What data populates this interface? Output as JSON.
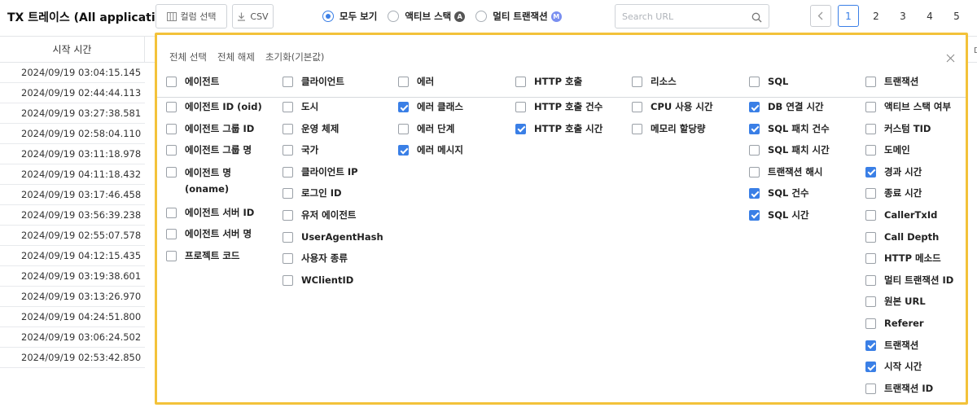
{
  "toolbar": {
    "title": "TX 트레이스 (All applications)",
    "column_select_label": "컬럼 선택",
    "csv_label": "CSV",
    "radios": [
      {
        "label": "모두 보기",
        "selected": true,
        "badge": ""
      },
      {
        "label": "액티브 스택",
        "selected": false,
        "badge": "A",
        "badge_color": "#555555"
      },
      {
        "label": "멀티 트랜잭션",
        "selected": false,
        "badge": "M",
        "badge_color": "#7a8ff0"
      }
    ],
    "search_placeholder": "Search URL",
    "pages": [
      "1",
      "2",
      "3",
      "4",
      "5"
    ],
    "active_page": "1"
  },
  "table": {
    "column_header": "시작 시간",
    "edge_header_fragment": "D",
    "rows": [
      "2024/09/19 03:04:15.145",
      "2024/09/19 02:44:44.113",
      "2024/09/19 03:27:38.581",
      "2024/09/19 02:58:04.110",
      "2024/09/19 03:11:18.978",
      "2024/09/19 04:11:18.432",
      "2024/09/19 03:17:46.458",
      "2024/09/19 03:56:39.238",
      "2024/09/19 02:55:07.578",
      "2024/09/19 04:12:15.435",
      "2024/09/19 03:19:38.601",
      "2024/09/19 03:13:26.970",
      "2024/09/19 04:24:51.800",
      "2024/09/19 03:06:24.502",
      "2024/09/19 02:53:42.850"
    ]
  },
  "panel": {
    "select_all": "전체 선택",
    "deselect_all": "전체 해제",
    "reset": "초기화(기본값)",
    "accent": "#f3c23a",
    "check_color": "#3a7fe6",
    "groups": [
      {
        "header": "에이전트",
        "checked": false,
        "items": [
          {
            "label": "에이전트 ID (oid)",
            "checked": false
          },
          {
            "label": "에이전트 그룹 ID",
            "checked": false
          },
          {
            "label": "에이전트 그룹 명",
            "checked": false
          },
          {
            "label": "에이전트 명 (oname)",
            "checked": false,
            "tall": true
          },
          {
            "label": "에이전트 서버 ID",
            "checked": false
          },
          {
            "label": "에이전트 서버 명",
            "checked": false
          },
          {
            "label": "프로젝트 코드",
            "checked": false
          }
        ]
      },
      {
        "header": "클라이언트",
        "checked": false,
        "items": [
          {
            "label": "도시",
            "checked": false
          },
          {
            "label": "운영 체제",
            "checked": false
          },
          {
            "label": "국가",
            "checked": false
          },
          {
            "label": "클라이언트 IP",
            "checked": false
          },
          {
            "label": "로그인 ID",
            "checked": false
          },
          {
            "label": "유저 에이전트",
            "checked": false
          },
          {
            "label": "UserAgentHash",
            "checked": false
          },
          {
            "label": "사용자 종류",
            "checked": false
          },
          {
            "label": "WClientID",
            "checked": false
          }
        ]
      },
      {
        "header": "에러",
        "checked": false,
        "items": [
          {
            "label": "에러 클래스",
            "checked": true
          },
          {
            "label": "에러 단계",
            "checked": false
          },
          {
            "label": "에러 메시지",
            "checked": true
          }
        ]
      },
      {
        "header": "HTTP 호출",
        "checked": false,
        "items": [
          {
            "label": "HTTP 호출 건수",
            "checked": false
          },
          {
            "label": "HTTP 호출 시간",
            "checked": true
          }
        ]
      },
      {
        "header": "리소스",
        "checked": false,
        "items": [
          {
            "label": "CPU 사용 시간",
            "checked": false
          },
          {
            "label": "메모리 할당량",
            "checked": false
          }
        ]
      },
      {
        "header": "SQL",
        "checked": false,
        "items": [
          {
            "label": "DB 연결 시간",
            "checked": true
          },
          {
            "label": "SQL 패치 건수",
            "checked": true
          },
          {
            "label": "SQL 패치 시간",
            "checked": false
          },
          {
            "label": "트랜잭션 해시",
            "checked": false
          },
          {
            "label": "SQL 건수",
            "checked": true
          },
          {
            "label": "SQL 시간",
            "checked": true
          }
        ]
      },
      {
        "header": "트랜잭션",
        "checked": false,
        "items": [
          {
            "label": "액티브 스택 여부",
            "checked": false
          },
          {
            "label": "커스텀 TID",
            "checked": false
          },
          {
            "label": "도메인",
            "checked": false
          },
          {
            "label": "경과 시간",
            "checked": true
          },
          {
            "label": "종료 시간",
            "checked": false
          },
          {
            "label": "CallerTxId",
            "checked": false
          },
          {
            "label": "Call Depth",
            "checked": false
          },
          {
            "label": "HTTP 메소드",
            "checked": false
          },
          {
            "label": "멀티 트랜잭션 ID",
            "checked": false
          },
          {
            "label": "원본 URL",
            "checked": false
          },
          {
            "label": "Referer",
            "checked": false
          },
          {
            "label": "트랜잭션",
            "checked": true
          },
          {
            "label": "시작 시간",
            "checked": true
          },
          {
            "label": "트랜잭션 ID",
            "checked": false
          }
        ]
      }
    ]
  }
}
